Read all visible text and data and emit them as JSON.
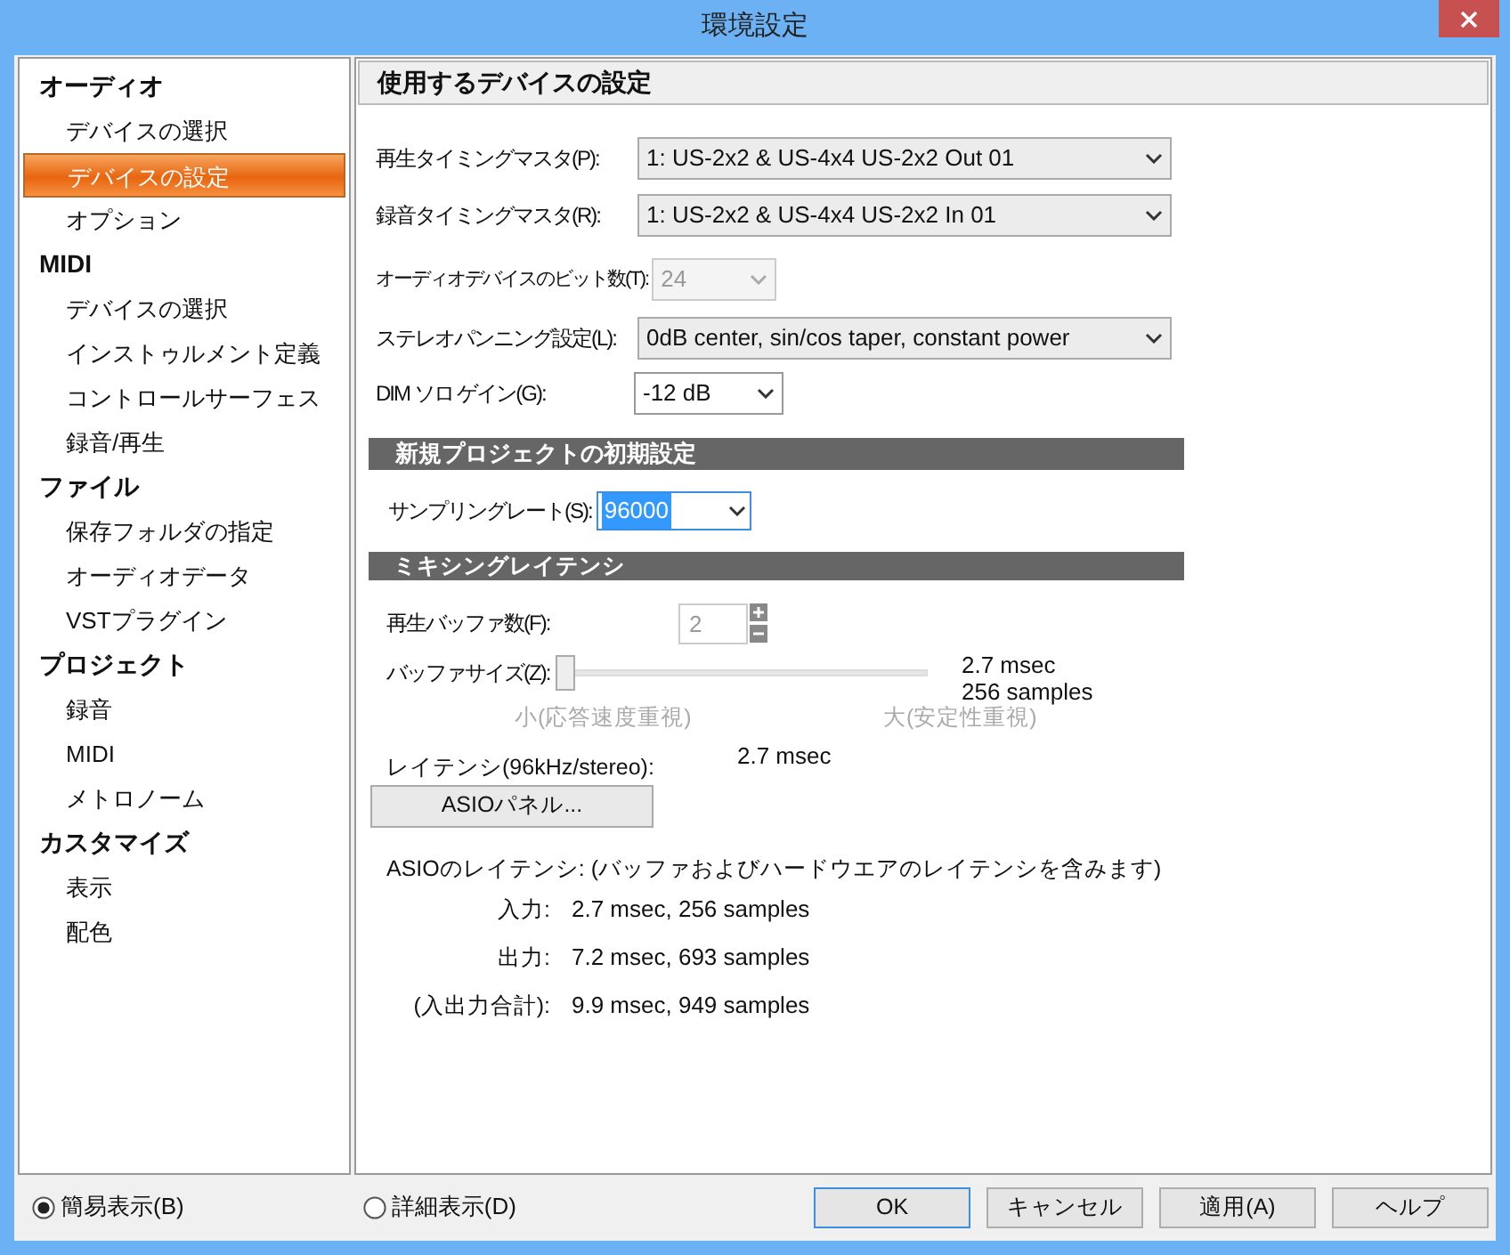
{
  "window": {
    "title": "環境設定"
  },
  "sidebar": {
    "groups": [
      {
        "label": "オーディオ",
        "items": [
          {
            "label": "デバイスの選択",
            "selected": false
          },
          {
            "label": "デバイスの設定",
            "selected": true
          },
          {
            "label": "オプション",
            "selected": false
          }
        ]
      },
      {
        "label": "MIDI",
        "items": [
          {
            "label": "デバイスの選択",
            "selected": false
          },
          {
            "label": "インストゥルメント定義",
            "selected": false
          },
          {
            "label": "コントロールサーフェス",
            "selected": false
          },
          {
            "label": "録音/再生",
            "selected": false
          }
        ]
      },
      {
        "label": "ファイル",
        "items": [
          {
            "label": "保存フォルダの指定",
            "selected": false
          },
          {
            "label": "オーディオデータ",
            "selected": false
          },
          {
            "label": "VSTプラグイン",
            "selected": false
          }
        ]
      },
      {
        "label": "プロジェクト",
        "items": [
          {
            "label": "録音",
            "selected": false
          },
          {
            "label": "MIDI",
            "selected": false
          },
          {
            "label": "メトロノーム",
            "selected": false
          }
        ]
      },
      {
        "label": "カスタマイズ",
        "items": [
          {
            "label": "表示",
            "selected": false
          },
          {
            "label": "配色",
            "selected": false
          }
        ]
      }
    ]
  },
  "panel": {
    "title": "使用するデバイスの設定",
    "device_fields": [
      {
        "label": "再生タイミングマスタ(P):",
        "value": "1: US-2x2 & US-4x4 US-2x2 Out 01",
        "disabled": false
      },
      {
        "label": "録音タイミングマスタ(R):",
        "value": "1: US-2x2 & US-4x4 US-2x2 In 01",
        "disabled": false
      },
      {
        "label": "オーディオデバイスのビット数(T):",
        "value": "24",
        "disabled": true
      },
      {
        "label": "ステレオパンニング設定(L):",
        "value": "0dB center, sin/cos taper, constant power",
        "disabled": false
      },
      {
        "label": "DIM ソロ ゲイン(G):",
        "value": "-12 dB",
        "disabled": false
      }
    ],
    "new_project": {
      "title": "新規プロジェクトの初期設定",
      "sample_rate": {
        "label": "サンプリングレート(S):",
        "value": "96000"
      }
    },
    "mixing_latency": {
      "title": "ミキシングレイテンシ",
      "buffer_count": {
        "label": "再生バッファ数(F):",
        "value": "2",
        "disabled": true
      },
      "buffer_size": {
        "label": "バッファサイズ(Z):",
        "level": 0,
        "reading_time": "2.7 msec",
        "reading_samples": "256 samples",
        "min_label": "小(応答速度重視)",
        "max_label": "大(安定性重視)"
      },
      "latency": {
        "label": "レイテンシ(96kHz/stereo):",
        "value": "2.7 msec"
      },
      "asio_button": "ASIOパネル...",
      "asio_latency": {
        "title": "ASIOのレイテンシ: (バッファおよびハードウエアのレイテンシを含みます)",
        "rows": [
          {
            "label": "入力:",
            "value": "2.7 msec, 256 samples"
          },
          {
            "label": "出力:",
            "value": "7.2 msec, 693 samples"
          },
          {
            "label": "(入出力合計):",
            "value": "9.9 msec, 949 samples"
          }
        ]
      }
    }
  },
  "view_modes": [
    {
      "label": "簡易表示(B)",
      "selected": true
    },
    {
      "label": "詳細表示(D)",
      "selected": false
    }
  ],
  "buttons": [
    {
      "label": "OK",
      "default": true
    },
    {
      "label": "キャンセル",
      "default": false
    },
    {
      "label": "適用(A)",
      "default": false
    },
    {
      "label": "ヘルプ",
      "default": false
    }
  ]
}
